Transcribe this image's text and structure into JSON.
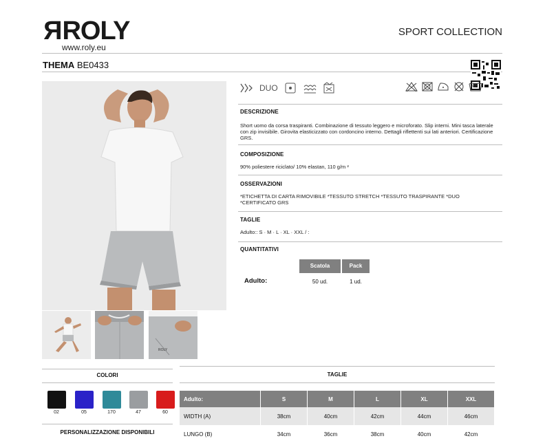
{
  "brand": {
    "logo_text": "ROLY",
    "url": "www.roly.eu",
    "collection": "SPORT COLLECTION"
  },
  "product": {
    "name": "THEMA",
    "code": "BE0433"
  },
  "feature_icons": [
    "dry-fit-icon",
    "duo-icon",
    "label-icon",
    "reflective-icon",
    "stretch-icon"
  ],
  "feature_duo_label": "DUO",
  "care_icons": [
    "no-bleach-icon",
    "no-tumble-dry-icon",
    "iron-icon",
    "no-dry-clean-icon",
    "wash-40-icon"
  ],
  "care_wash_temp": "40°",
  "sections": {
    "descrizione_h": "DESCRIZIONE",
    "descrizione": "Short uomo da corsa traspiranti. Combinazione di tessuto leggero e microforato. Slip interni. Mini tasca laterale con zip invisibile. Girovita elasticizzato con cordoncino interno. Dettagli riflettenti sui lati anteriori. Certificazione GRS.",
    "composizione_h": "COMPOSIZIONE",
    "composizione": "90% poliestere riciclato/ 10% elastan, 110 g/m ²",
    "osservazioni_h": "OSSERVAZIONI",
    "osservazioni": "*ETICHETTA DI CARTA RIMOVIBILE *TESSUTO STRETCH *TESSUTO TRASPIRANTE *DUO *CERTIFICATO GRS",
    "taglie_h": "TAGLIE",
    "taglie": "Adulto:: S · M · L · XL · XXL / :",
    "quantitativi_h": "QUANTITATIVI"
  },
  "quantities": {
    "headers": [
      "Scatola",
      "Pack"
    ],
    "row_label": "Adulto:",
    "values": [
      "50 ud.",
      "1 ud."
    ]
  },
  "colori": {
    "title": "COLORI",
    "items": [
      {
        "code": "02",
        "color": "#111111"
      },
      {
        "code": "05",
        "color": "#2a22c8"
      },
      {
        "code": "170",
        "color": "#2f8a99"
      },
      {
        "code": "47",
        "color": "#9a9da0"
      },
      {
        "code": "60",
        "color": "#d81c1c"
      }
    ]
  },
  "personalizzazione": {
    "title": "PERSONALIZZAZIONE DISPONIBILI"
  },
  "size_table": {
    "title": "TAGLIE",
    "headers": [
      "Adulto:",
      "S",
      "M",
      "L",
      "XL",
      "XXL"
    ],
    "rows": [
      {
        "label": "WIDTH (A)",
        "values": [
          "38cm",
          "40cm",
          "42cm",
          "44cm",
          "46cm"
        ]
      },
      {
        "label": "LUNGO (B)",
        "values": [
          "34cm",
          "36cm",
          "38cm",
          "40cm",
          "42cm"
        ]
      }
    ]
  }
}
